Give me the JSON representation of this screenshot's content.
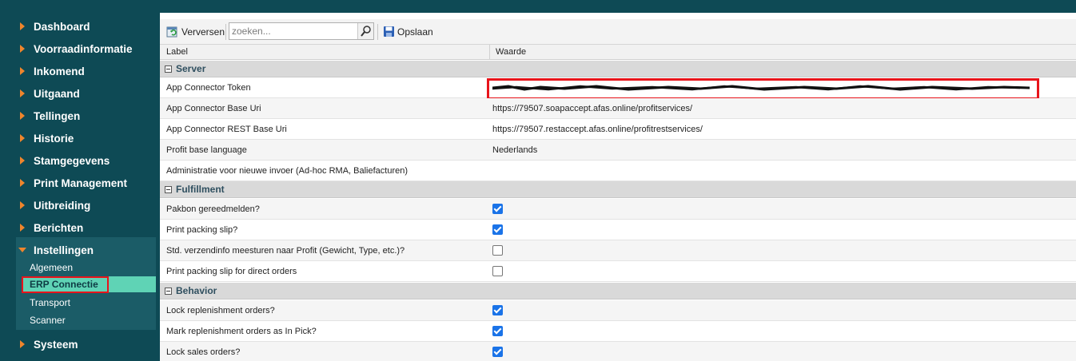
{
  "sidebar": {
    "items": [
      {
        "label": "Dashboard"
      },
      {
        "label": "Voorraadinformatie"
      },
      {
        "label": "Inkomend"
      },
      {
        "label": "Uitgaand"
      },
      {
        "label": "Tellingen"
      },
      {
        "label": "Historie"
      },
      {
        "label": "Stamgegevens"
      },
      {
        "label": "Print Management"
      },
      {
        "label": "Uitbreiding"
      },
      {
        "label": "Berichten"
      },
      {
        "label": "Instellingen"
      },
      {
        "label": "Systeem"
      }
    ],
    "sub_items": [
      {
        "label": "Algemeen"
      },
      {
        "label": "ERP Connectie"
      },
      {
        "label": "Transport"
      },
      {
        "label": "Scanner"
      }
    ],
    "active_sub": "ERP Connectie"
  },
  "toolbar": {
    "refresh_label": "Verversen",
    "search_placeholder": "zoeken...",
    "save_label": "Opslaan"
  },
  "grid": {
    "columns": [
      "Label",
      "Waarde"
    ],
    "groups": [
      {
        "name": "Server",
        "rows": [
          {
            "label": "App Connector Token",
            "value": "",
            "type": "redacted"
          },
          {
            "label": "App Connector Base Uri",
            "value": "https://79507.soapaccept.afas.online/profitservices/",
            "type": "text"
          },
          {
            "label": "App Connector REST Base Uri",
            "value": "https://79507.restaccept.afas.online/profitrestservices/",
            "type": "text"
          },
          {
            "label": "Profit base language",
            "value": "Nederlands",
            "type": "text"
          },
          {
            "label": "Administratie voor nieuwe invoer (Ad-hoc RMA, Baliefacturen)",
            "value": "",
            "type": "text"
          }
        ]
      },
      {
        "name": "Fulfillment",
        "rows": [
          {
            "label": "Pakbon gereedmelden?",
            "checked": true,
            "type": "checkbox"
          },
          {
            "label": "Print packing slip?",
            "checked": true,
            "type": "checkbox"
          },
          {
            "label": "Std. verzendinfo meesturen naar Profit (Gewicht, Type, etc.)?",
            "checked": false,
            "type": "checkbox"
          },
          {
            "label": "Print packing slip for direct orders",
            "checked": false,
            "type": "checkbox"
          }
        ]
      },
      {
        "name": "Behavior",
        "rows": [
          {
            "label": "Lock replenishment orders?",
            "checked": true,
            "type": "checkbox"
          },
          {
            "label": "Mark replenishment orders as In Pick?",
            "checked": true,
            "type": "checkbox"
          },
          {
            "label": "Lock sales orders?",
            "checked": true,
            "type": "checkbox"
          }
        ]
      }
    ]
  },
  "colors": {
    "sidebar_bg": "#0e4a55",
    "accent_orange": "#f0852c",
    "active_item": "#5fd3b5",
    "highlight_red": "#e8141b",
    "checkbox_blue": "#1a73e8"
  }
}
